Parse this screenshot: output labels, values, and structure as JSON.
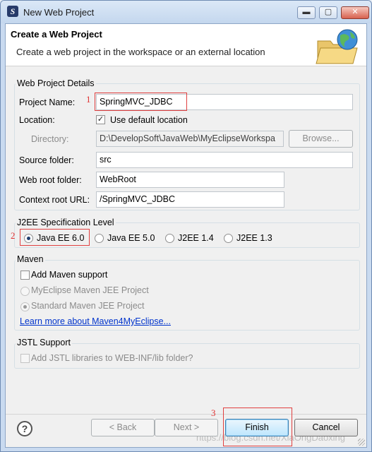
{
  "window": {
    "title": "New Web Project",
    "controls": {
      "minimize": "▬",
      "maximize": "▢",
      "close": "✕"
    }
  },
  "header": {
    "title": "Create a Web Project",
    "description": "Create a web project in the workspace or an external location",
    "icon": "globe-folder-icon"
  },
  "details": {
    "group_title": "Web Project Details",
    "project_name_label": "Project Name:",
    "project_name_value": "SpringMVC_JDBC",
    "location_label": "Location:",
    "use_default_label": "Use default location",
    "use_default_checked": true,
    "directory_label": "Directory:",
    "directory_value": "D:\\DevelopSoft\\JavaWeb\\MyEclipseWorkspa",
    "browse_label": "Browse...",
    "source_folder_label": "Source folder:",
    "source_folder_value": "src",
    "web_root_label": "Web root folder:",
    "web_root_value": "WebRoot",
    "context_root_label": "Context root URL:",
    "context_root_value": "/SpringMVC_JDBC"
  },
  "j2ee": {
    "group_title": "J2EE Specification Level",
    "options": [
      "Java EE 6.0",
      "Java EE 5.0",
      "J2EE 1.4",
      "J2EE 1.3"
    ],
    "selected": "Java EE 6.0"
  },
  "maven": {
    "group_title": "Maven",
    "add_support_label": "Add Maven support",
    "option_jee": "MyEclipse Maven JEE Project",
    "option_standard": "Standard Maven JEE Project",
    "learn_more": "Learn more about Maven4MyEclipse..."
  },
  "jstl": {
    "group_title": "JSTL Support",
    "add_jstl_label": "Add JSTL libraries to WEB-INF/lib folder?"
  },
  "buttons": {
    "help": "?",
    "back": "< Back",
    "next": "Next >",
    "finish": "Finish",
    "cancel": "Cancel"
  },
  "annotations": {
    "one": "1",
    "two": "2",
    "three": "3"
  },
  "watermark": "https://blog.csdn.net/XiaOngDaoxing",
  "colors": {
    "annotation": "#e03030",
    "link": "#0033cc",
    "title_bar": "#c9daf0"
  }
}
